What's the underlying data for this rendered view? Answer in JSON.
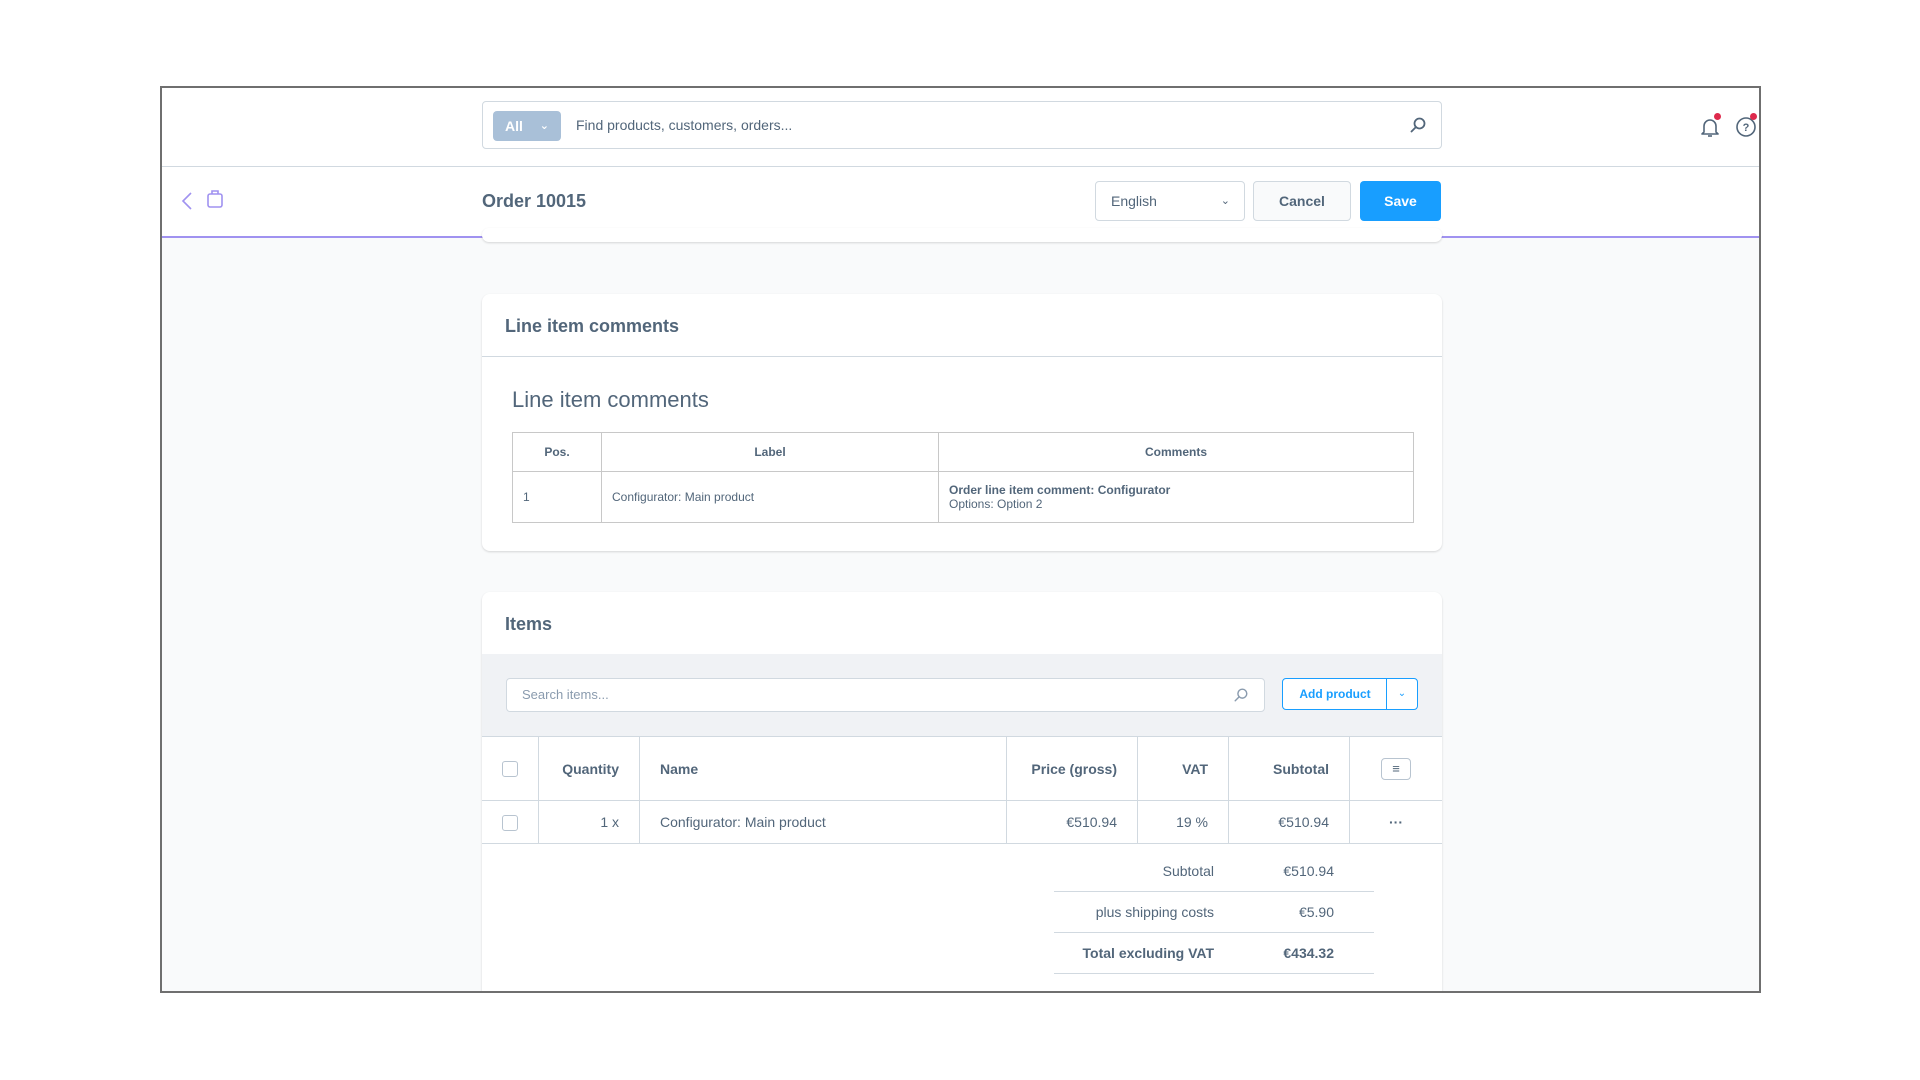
{
  "search": {
    "scope": "All",
    "placeholder": "Find products, customers, orders..."
  },
  "header": {
    "title": "Order 10015",
    "language": "English",
    "cancel": "Cancel",
    "save": "Save"
  },
  "colors": {
    "primary": "#189eff",
    "accent_line": "#a092f0",
    "notification": "#de294c"
  },
  "comments_card": {
    "title": "Line item comments",
    "heading": "Line item comments",
    "columns": [
      "Pos.",
      "Label",
      "Comments"
    ],
    "rows": [
      {
        "pos": "1",
        "label": "Configurator: Main product",
        "comment_title": "Order line item comment: Configurator",
        "comment_detail": "Options: Option 2"
      }
    ]
  },
  "items_card": {
    "title": "Items",
    "search_placeholder": "Search items...",
    "add_product": "Add product",
    "columns": [
      "Quantity",
      "Name",
      "Price (gross)",
      "VAT",
      "Subtotal"
    ],
    "rows": [
      {
        "quantity": "1 x",
        "name": "Configurator: Main product",
        "price": "€510.94",
        "vat": "19 %",
        "subtotal": "€510.94",
        "actions": "···"
      }
    ],
    "summary": [
      {
        "label": "Subtotal",
        "value": "€510.94"
      },
      {
        "label": "plus shipping costs",
        "value": "€5.90"
      },
      {
        "label": "Total excluding VAT",
        "value": "€434.32"
      }
    ]
  }
}
